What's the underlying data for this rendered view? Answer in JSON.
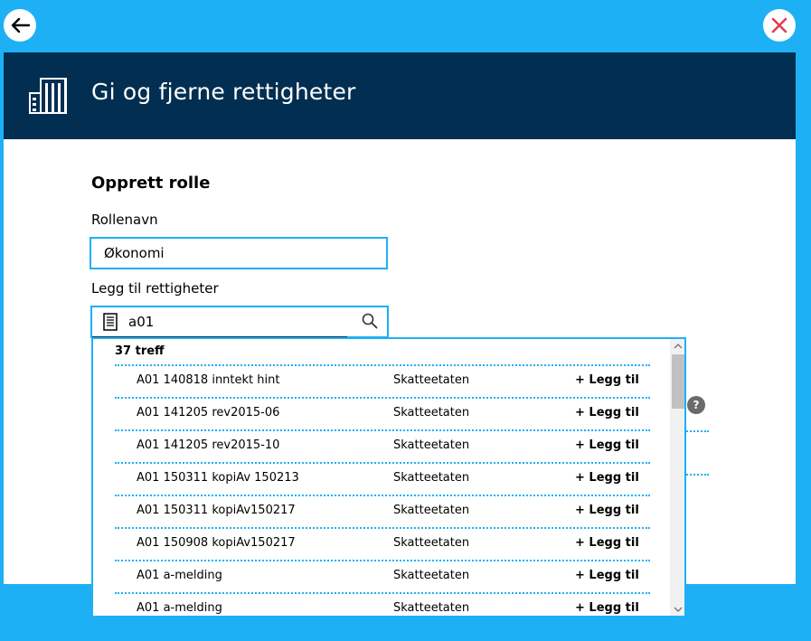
{
  "topbar": {
    "back_icon": "arrow-left-icon",
    "close_icon": "close-x-icon",
    "close_color": "#e23b53"
  },
  "header": {
    "icon": "building-icon",
    "title": "Gi og fjerne rettigheter",
    "background": "#022f51"
  },
  "form": {
    "section_title": "Opprett rolle",
    "role_name_label": "Rollenavn",
    "role_name_value": "Økonomi",
    "rights_label": "Legg til rettigheter",
    "search_value": "a01",
    "search_leading_icon": "document-icon",
    "search_trailing_icon": "search-icon"
  },
  "results": {
    "count_label": "37 treff",
    "items": [
      {
        "name": "A01 140818 inntekt hint",
        "owner": "Skatteetaten",
        "action": "+ Legg til"
      },
      {
        "name": "A01 141205 rev2015-06",
        "owner": "Skatteetaten",
        "action": "+ Legg til"
      },
      {
        "name": "A01 141205 rev2015-10",
        "owner": "Skatteetaten",
        "action": "+ Legg til"
      },
      {
        "name": "A01 150311 kopiAv 150213",
        "owner": "Skatteetaten",
        "action": "+ Legg til"
      },
      {
        "name": "A01 150311 kopiAv150217",
        "owner": "Skatteetaten",
        "action": "+ Legg til"
      },
      {
        "name": "A01 150908 kopiAv150217",
        "owner": "Skatteetaten",
        "action": "+ Legg til"
      },
      {
        "name": "A01 a-melding",
        "owner": "Skatteetaten",
        "action": "+ Legg til"
      },
      {
        "name": "A01 a-melding",
        "owner": "Skatteetaten",
        "action": "+ Legg til"
      }
    ]
  },
  "help": {
    "label": "?"
  },
  "colors": {
    "accent": "#1eb0f5",
    "dark": "#022f51"
  }
}
